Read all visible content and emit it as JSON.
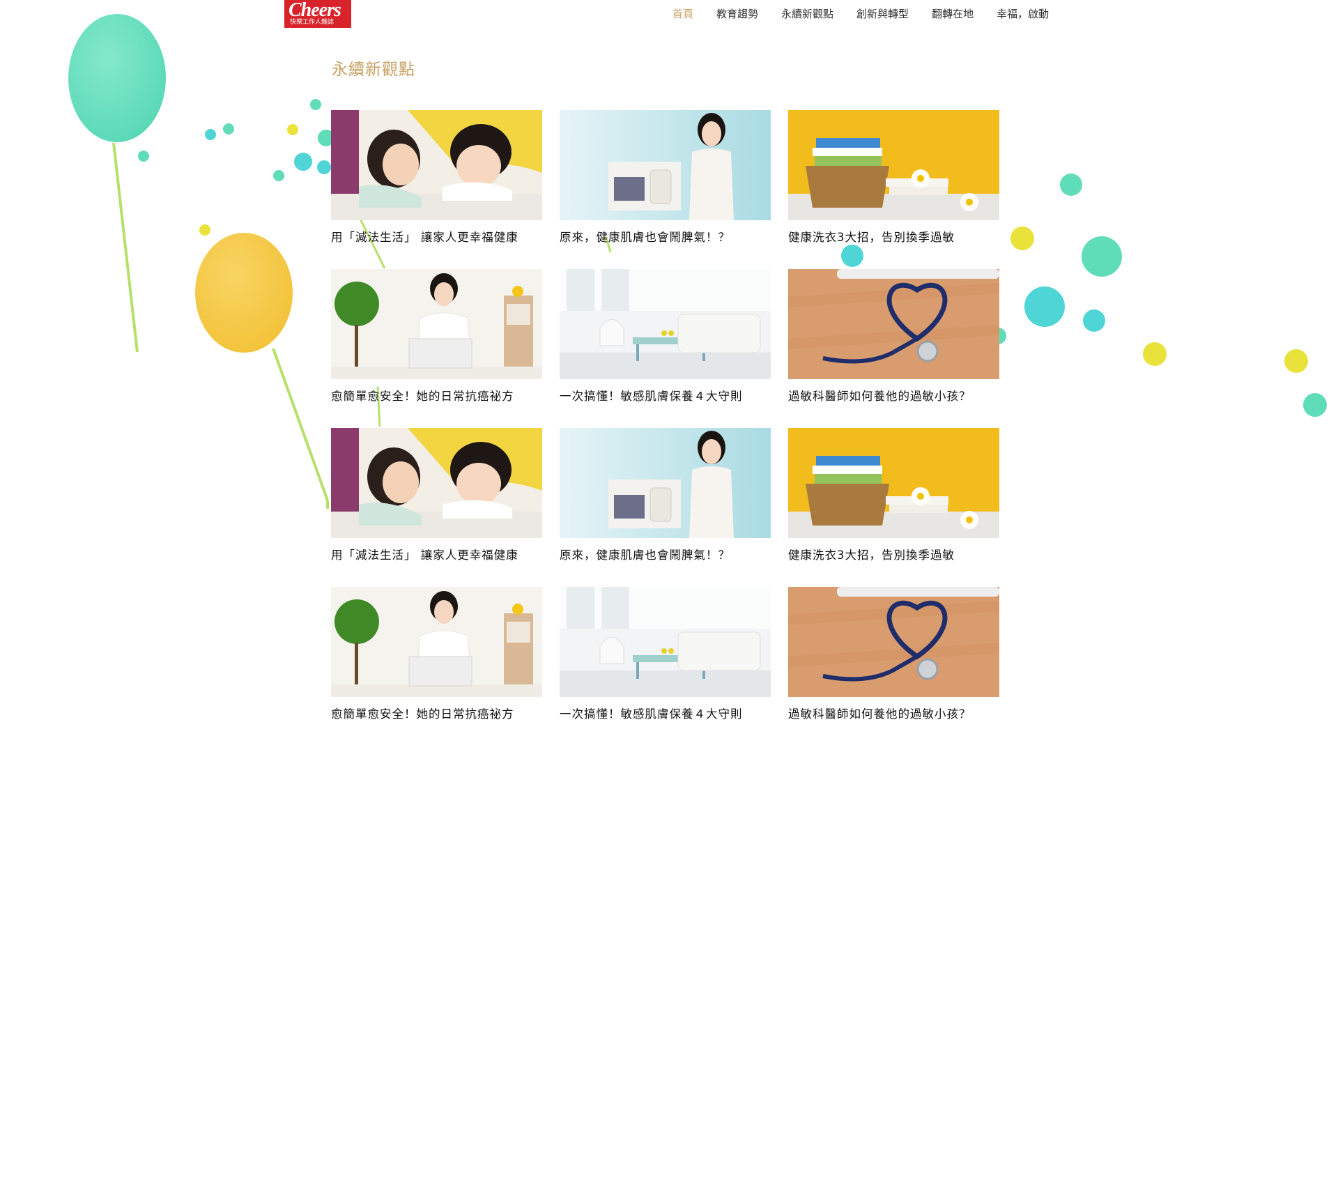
{
  "header": {
    "logo": {
      "word": "Cheers",
      "sub": "快樂工作人雜誌"
    },
    "nav": [
      {
        "label": "首頁",
        "active": true
      },
      {
        "label": "教育趨勢",
        "active": false
      },
      {
        "label": "永續新觀點",
        "active": false
      },
      {
        "label": "創新與轉型",
        "active": false
      },
      {
        "label": "翻轉在地",
        "active": false
      },
      {
        "label": "幸福，啟動",
        "active": false
      }
    ],
    "accent_color": "#c8a062",
    "brand_color": "#d8232a"
  },
  "main": {
    "title": "永續新觀點",
    "articles": [
      {
        "title": "用「減法生活」 讓家人更幸福健康",
        "image": "mother-daughter-photo"
      },
      {
        "title": "原來，健康肌膚也會鬧脾氣！？",
        "image": "woman-holding-laundry-sign-photo"
      },
      {
        "title": "健康洗衣3大招，告別換季過敏",
        "image": "laundry-basket-photo"
      },
      {
        "title": "愈簡單愈安全！她的日常抗癌祕方",
        "image": "woman-laptop-photo"
      },
      {
        "title": "一次搞懂！敏感肌膚保養４大守則",
        "image": "living-room-photo"
      },
      {
        "title": "過敏科醫師如何養他的過敏小孩？",
        "image": "stethoscope-heart-photo"
      },
      {
        "title": "用「減法生活」 讓家人更幸福健康",
        "image": "mother-daughter-photo"
      },
      {
        "title": "原來，健康肌膚也會鬧脾氣！？",
        "image": "woman-holding-laundry-sign-photo"
      },
      {
        "title": "健康洗衣3大招，告別換季過敏",
        "image": "laundry-basket-photo"
      },
      {
        "title": "愈簡單愈安全！她的日常抗癌祕方",
        "image": "woman-laptop-photo"
      },
      {
        "title": "一次搞懂！敏感肌膚保養４大守則",
        "image": "living-room-photo"
      },
      {
        "title": "過敏科醫師如何養他的過敏小孩？",
        "image": "stethoscope-heart-photo"
      }
    ]
  },
  "decoration": {
    "balloon_colors": [
      "#5fdcb8",
      "#f5c63c"
    ],
    "dot_colors": [
      "#4fd5d5",
      "#e9e23a",
      "#5fdcb8"
    ]
  }
}
